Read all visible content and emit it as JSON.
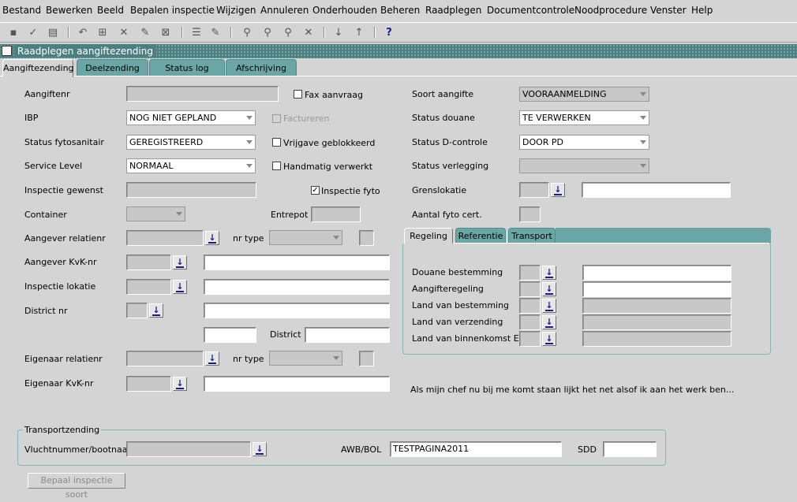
{
  "menu": [
    "Bestand",
    "Bewerken",
    "Beeld",
    "Bepalen inspectie",
    "Wijzigen",
    "Annuleren",
    "Onderhouden",
    "Beheren",
    "Raadplegen",
    "Documentcontrole",
    "Noodprocedure",
    "Venster",
    "Help"
  ],
  "window": {
    "title": "Raadplegen aangiftezending"
  },
  "tabs": [
    "Aangiftezending",
    "Deelzending",
    "Status log",
    "Afschrijving"
  ],
  "labels": {
    "aangiftenr": "Aangiftenr",
    "ibp": "IBP",
    "status_fytosanitair": "Status fytosanitair",
    "service_level": "Service Level",
    "inspectie_gewenst": "Inspectie gewenst",
    "container": "Container",
    "entrepot": "Entrepot",
    "aangever_relatienr": "Aangever relatienr",
    "nr_type_1": "nr type",
    "aangever_kvk": "Aangever KvK-nr",
    "inspectie_lokatie": "Inspectie lokatie",
    "district_nr": "District nr",
    "district": "District",
    "eigenaar_relatienr": "Eigenaar relatienr",
    "nr_type_2": "nr type",
    "eigenaar_kvk": "Eigenaar KvK-nr",
    "soort_aangifte": "Soort aangifte",
    "status_douane": "Status douane",
    "status_dcontrole": "Status D-controle",
    "status_verlegging": "Status verlegging",
    "grenslokatie": "Grenslokatie",
    "aantal_fyto": "Aantal fyto cert."
  },
  "checkboxes": {
    "fax_aanvraag": "Fax aanvraag",
    "factureren": "Factureren",
    "vrijgave_geblokkeerd": "Vrijgave geblokkeerd",
    "handmatig_verwerkt": "Handmatig verwerkt",
    "inspectie_fyto": "Inspectie fyto",
    "checked_mark": "✓"
  },
  "values": {
    "ibp": "NOG NIET GEPLAND",
    "status_fytosanitair": "GEREGISTREERD",
    "service_level": "NORMAAL",
    "soort_aangifte": "VOORAANMELDING",
    "status_douane": "TE VERWERKEN",
    "status_dcontrole": "DOOR PD"
  },
  "subtabs": [
    "Regeling",
    "Referentie",
    "Transport"
  ],
  "regeling": {
    "douane_bestemming": "Douane bestemming",
    "aangifteregeling": "Aangifteregeling",
    "land_bestemming": "Land van bestemming",
    "land_verzending": "Land van verzending",
    "land_binnenkomst": "Land van binnenkomst EU"
  },
  "note": "Als mijn chef nu bij me komt staan lijkt het net alsof ik aan het werk ben...",
  "transport": {
    "title": "Transportzending",
    "vluchtnummer": "Vluchtnummer/bootnaam",
    "awb_label": "AWB/BOL",
    "awb_value": "TESTPAGINA2011",
    "sdd": "SDD"
  },
  "button": {
    "bepaal": "Bepaal inspectie soort"
  },
  "lov_glyph": "↓",
  "colors": {
    "title_bar": "#4c7f7f",
    "tab_inactive": "#6aa6a6",
    "background": "#d4d4d4"
  }
}
